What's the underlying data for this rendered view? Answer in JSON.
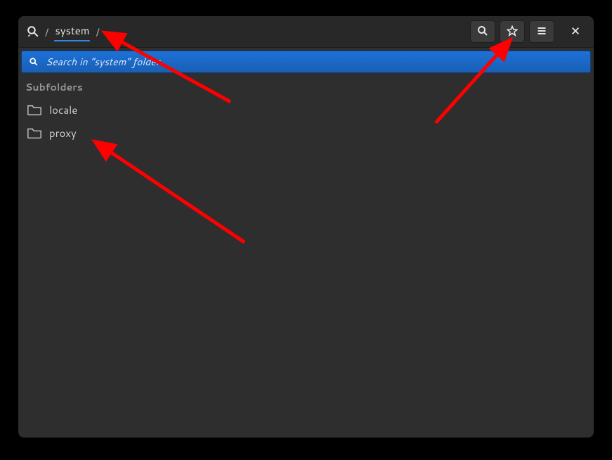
{
  "breadcrumb": {
    "separator": "/",
    "current": "system",
    "trailing": "/"
  },
  "toolbar": {
    "search_name": "search",
    "bookmark_name": "bookmark",
    "menu_name": "menu",
    "close_name": "close"
  },
  "search": {
    "placeholder": "Search in “system” folder",
    "value": ""
  },
  "section": {
    "subfolders_label": "Subfolders"
  },
  "subfolders": [
    {
      "name": "locale"
    },
    {
      "name": "proxy"
    }
  ],
  "annotation": {
    "arrow_color": "#ff0000"
  }
}
